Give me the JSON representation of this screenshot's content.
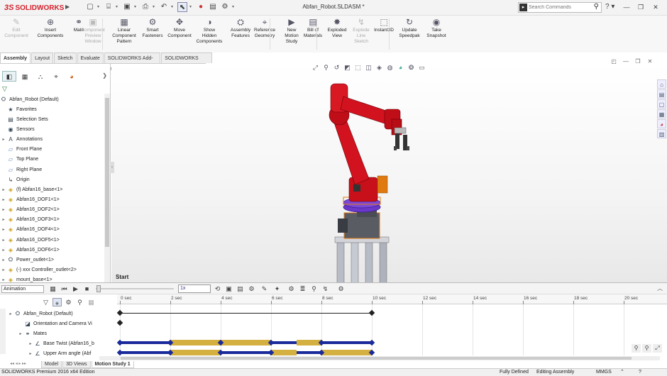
{
  "app": {
    "brand_prefix": "3S",
    "brand_name": "SOLIDWORKS",
    "document_title": "Abfan_Robot.SLDASM *",
    "search_placeholder": "Search Commands"
  },
  "ribbon": {
    "buttons": [
      {
        "label": "Edit\nComponent",
        "icon": "edit-component-icon",
        "enabled": false
      },
      {
        "label": "Insert\nComponents",
        "icon": "insert-components-icon",
        "enabled": true
      },
      {
        "label": "Mate",
        "icon": "mate-icon",
        "enabled": true
      },
      {
        "label": "Component\nPreview\nWindow",
        "icon": "component-preview-icon",
        "enabled": false
      },
      {
        "label": "Linear\nComponent\nPattern",
        "icon": "linear-pattern-icon",
        "enabled": true
      },
      {
        "label": "Smart\nFasteners",
        "icon": "smart-fasteners-icon",
        "enabled": true
      },
      {
        "label": "Move\nComponent",
        "icon": "move-component-icon",
        "enabled": true
      },
      {
        "label": "Show\nHidden\nComponents",
        "icon": "show-hidden-icon",
        "enabled": true
      },
      {
        "label": "Assembly\nFeatures",
        "icon": "assembly-features-icon",
        "enabled": true
      },
      {
        "label": "Reference\nGeometry",
        "icon": "reference-geometry-icon",
        "enabled": true
      },
      {
        "label": "New\nMotion\nStudy",
        "icon": "new-motion-study-icon",
        "enabled": true
      },
      {
        "label": "Bill of\nMaterials",
        "icon": "bill-of-materials-icon",
        "enabled": true
      },
      {
        "label": "Exploded\nView",
        "icon": "exploded-view-icon",
        "enabled": true
      },
      {
        "label": "Explode\nLine\nSketch",
        "icon": "explode-line-sketch-icon",
        "enabled": false
      },
      {
        "label": "Instant3D",
        "icon": "instant3d-icon",
        "enabled": true
      },
      {
        "label": "Update\nSpeedpak",
        "icon": "update-speedpak-icon",
        "enabled": true
      },
      {
        "label": "Take\nSnapshot",
        "icon": "take-snapshot-icon",
        "enabled": true
      }
    ]
  },
  "command_tabs": [
    "Assembly",
    "Layout",
    "Sketch",
    "Evaluate",
    "SOLIDWORKS Add-Ins",
    "SOLIDWORKS MBD"
  ],
  "feature_tree": {
    "root": "Abfan_Robot  (Default)",
    "items": [
      {
        "label": "Favorites",
        "icon": "favorites-icon",
        "expandable": false
      },
      {
        "label": "Selection Sets",
        "icon": "selection-sets-icon",
        "expandable": false
      },
      {
        "label": "Sensors",
        "icon": "sensors-icon",
        "expandable": false
      },
      {
        "label": "Annotations",
        "icon": "annotations-icon",
        "expandable": true
      },
      {
        "label": "Front Plane",
        "icon": "plane-icon",
        "expandable": false
      },
      {
        "label": "Top Plane",
        "icon": "plane-icon",
        "expandable": false
      },
      {
        "label": "Right Plane",
        "icon": "plane-icon",
        "expandable": false
      },
      {
        "label": "Origin",
        "icon": "origin-icon",
        "expandable": false
      },
      {
        "label": "(f) Abfan16_base<1>",
        "icon": "part-icon",
        "expandable": true
      },
      {
        "label": "Abfan16_DOF1<1>",
        "icon": "part-icon",
        "expandable": true
      },
      {
        "label": "Abfan16_DOF2<1>",
        "icon": "part-icon",
        "expandable": true
      },
      {
        "label": "Abfan16_DOF3<1>",
        "icon": "part-icon",
        "expandable": true
      },
      {
        "label": "Abfan16_DOF4<1>",
        "icon": "part-icon",
        "expandable": true
      },
      {
        "label": "Abfan16_DOF5<1>",
        "icon": "part-icon",
        "expandable": true
      },
      {
        "label": "Abfan16_DOF6<1>",
        "icon": "part-icon",
        "expandable": true
      },
      {
        "label": "Power_outlet<1>",
        "icon": "assembly-icon",
        "expandable": true
      },
      {
        "label": "(-) xxx Controller_outlet<2>",
        "icon": "part-icon",
        "expandable": true
      },
      {
        "label": "mount_base<1>",
        "icon": "part-icon",
        "expandable": true
      }
    ]
  },
  "motion_study": {
    "start_label": "Start",
    "type": "Animation",
    "playback_speed": "1x",
    "time_unit_labels": [
      "0 sec",
      "2 sec",
      "4 sec",
      "6 sec",
      "8 sec",
      "10 sec",
      "12 sec",
      "14 sec",
      "16 sec",
      "18 sec",
      "20 sec"
    ],
    "tree": [
      {
        "label": "Abfan_Robot  (Default)",
        "icon": "assembly-icon",
        "level": 0
      },
      {
        "label": "Orientation and Camera Vi",
        "icon": "camera-icon",
        "level": 1
      },
      {
        "label": "Mates",
        "icon": "mates-icon",
        "level": 1
      },
      {
        "label": "Base Twist (Abfan16_b",
        "icon": "mate-angle-icon",
        "level": 2
      },
      {
        "label": "Upper Arm angle (Abf",
        "icon": "mate-angle-icon",
        "level": 2
      }
    ],
    "colors": {
      "key_bar": "#1a2a9a",
      "change_bar": "#d4b040"
    }
  },
  "doc_tabs": [
    "Model",
    "3D Views",
    "Motion Study 1"
  ],
  "status": {
    "edition": "SOLIDWORKS Premium 2016 x64 Edition",
    "definition": "Fully Defined",
    "mode": "Editing Assembly",
    "units": "MMGS"
  }
}
